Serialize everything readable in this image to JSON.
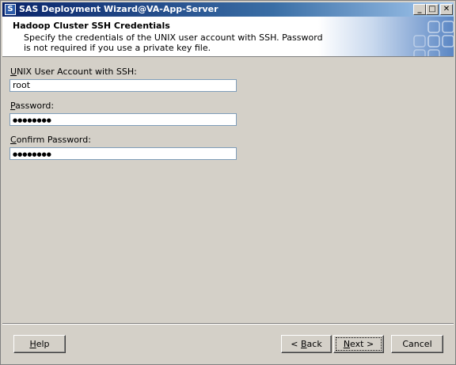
{
  "window": {
    "icon_glyph": "S",
    "title": "SAS Deployment Wizard@VA-App-Server",
    "controls": {
      "minimize": "_",
      "maximize": "□",
      "close": "✕"
    }
  },
  "banner": {
    "title": "Hadoop Cluster SSH Credentials",
    "description": "Specify the credentials of the UNIX user account with SSH. Password is not required if you use a private key file."
  },
  "form": {
    "user_label_mnemonic": "U",
    "user_label_rest": "NIX User Account with SSH:",
    "user_value": "root",
    "password_label_mnemonic": "P",
    "password_label_rest": "assword:",
    "password_value": "●●●●●●●●",
    "confirm_label_mnemonic": "C",
    "confirm_label_rest": "onfirm Password:",
    "confirm_value": "●●●●●●●●"
  },
  "buttons": {
    "help_mnemonic": "H",
    "help_rest": "elp",
    "back_prefix": "< ",
    "back_mnemonic": "B",
    "back_rest": "ack",
    "next_mnemonic": "N",
    "next_rest": "ext >",
    "cancel": "Cancel"
  }
}
